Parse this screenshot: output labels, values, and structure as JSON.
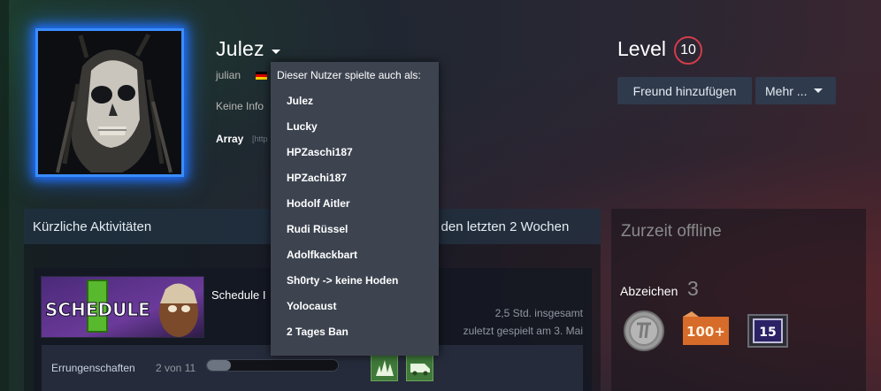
{
  "profile": {
    "persona_name": "Julez",
    "real_name": "julian",
    "no_info": "Keine Info",
    "array_label": "Array",
    "array_link": "[http",
    "level_label": "Level",
    "level": "10",
    "colors": {
      "avatar_glow": "#3a8dff",
      "level_ring": "#d13c4b"
    }
  },
  "buttons": {
    "add_friend": "Freund hinzufügen",
    "more": "Mehr ..."
  },
  "alias_dropdown": {
    "header": "Dieser Nutzer spielte auch als:",
    "aliases": [
      "Julez",
      "Lucky",
      "HPZaschi187",
      "HPZachi187",
      "Hodolf Aitler",
      "Rudi Rüssel",
      "Adolfkackbart",
      "Sh0rty -> keine Hoden",
      "Yolocaust",
      "2 Tages Ban"
    ]
  },
  "activity": {
    "title": "Kürzliche Aktivitäten",
    "hours_summary": "n den letzten 2 Wochen",
    "game": {
      "name": "Schedule I",
      "capsule_text": "SCHEDULE",
      "total": "2,5 Std. insgesamt",
      "last_played": "zuletzt gespielt am 3. Mai",
      "achievements_label": "Errungenschaften",
      "achievements_count": "2 von 11",
      "achievements_progress": 0.18,
      "achievement_icons": [
        "grass-icon",
        "van-icon"
      ]
    }
  },
  "sidebar": {
    "status": "Zurzeit offline",
    "badges_label": "Abzeichen",
    "badges_count": "3",
    "badges": [
      {
        "name": "silver-coin-badge"
      },
      {
        "name": "100-plus-badge",
        "text": "100+"
      },
      {
        "name": "years-service-badge",
        "text": "15"
      }
    ]
  }
}
